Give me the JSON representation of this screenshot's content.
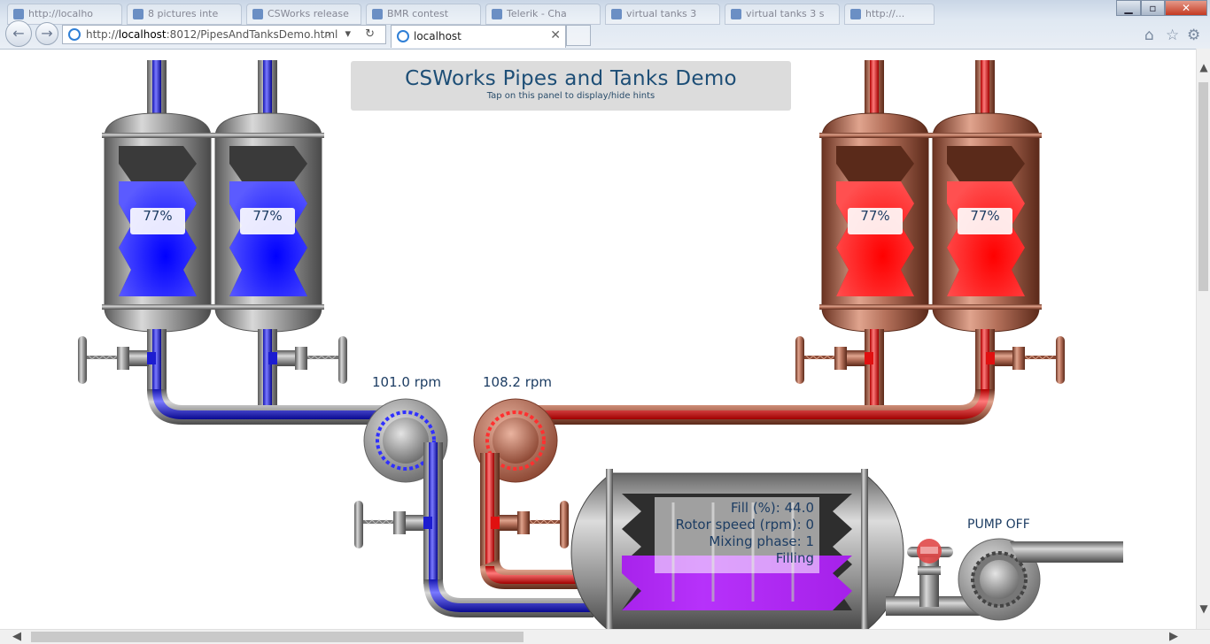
{
  "browser": {
    "background_tabs": [
      "http://localho",
      "8 pictures inte",
      "CSWorks release",
      "BMR contest",
      "Telerik - Cha",
      "virtual tanks 3",
      "virtual tanks 3 s",
      "http://..."
    ],
    "address_prefix": "http://",
    "address_host": "localhost",
    "address_rest": ":8012/PipesAndTanksDemo.html",
    "active_tab_title": "localhost",
    "close_glyph": "✕",
    "back_glyph": "←",
    "forward_glyph": "→",
    "search_tools": "⌕ ▾ ↻",
    "home_glyph": "⌂",
    "star_glyph": "☆",
    "gear_glyph": "⚙",
    "min_glyph": "▁",
    "max_glyph": "▫",
    "win_close_glyph": "✕"
  },
  "demo": {
    "title": "CSWorks Pipes and Tanks Demo",
    "subtitle": "Tap on this panel to display/hide hints",
    "tanks": [
      {
        "label": "77%",
        "level": 0.77,
        "color": "blue"
      },
      {
        "label": "77%",
        "level": 0.77,
        "color": "blue"
      },
      {
        "label": "77%",
        "level": 0.77,
        "color": "red"
      },
      {
        "label": "77%",
        "level": 0.77,
        "color": "red"
      }
    ],
    "rotors": [
      {
        "rpm_label": "101.0 rpm"
      },
      {
        "rpm_label": "108.2 rpm"
      }
    ],
    "mixer": {
      "fill_line": "Fill (%): 44.0",
      "rotor_line": "Rotor speed (rpm): 0",
      "phase_line": "Mixing phase: 1",
      "state_line": "Filling",
      "fill_fraction": 0.44
    },
    "pump": {
      "status": "PUMP OFF"
    },
    "colors": {
      "blue_liquid": "#2f2fff",
      "red_liquid": "#ff1f1f",
      "purple_liquid": "#b21bff",
      "steel": "#8a8a8a",
      "copper": "#a86048",
      "title_text": "#1d4e76"
    }
  },
  "scrollbars": {
    "up": "▲",
    "down": "▼",
    "left": "◀",
    "right": "▶"
  }
}
